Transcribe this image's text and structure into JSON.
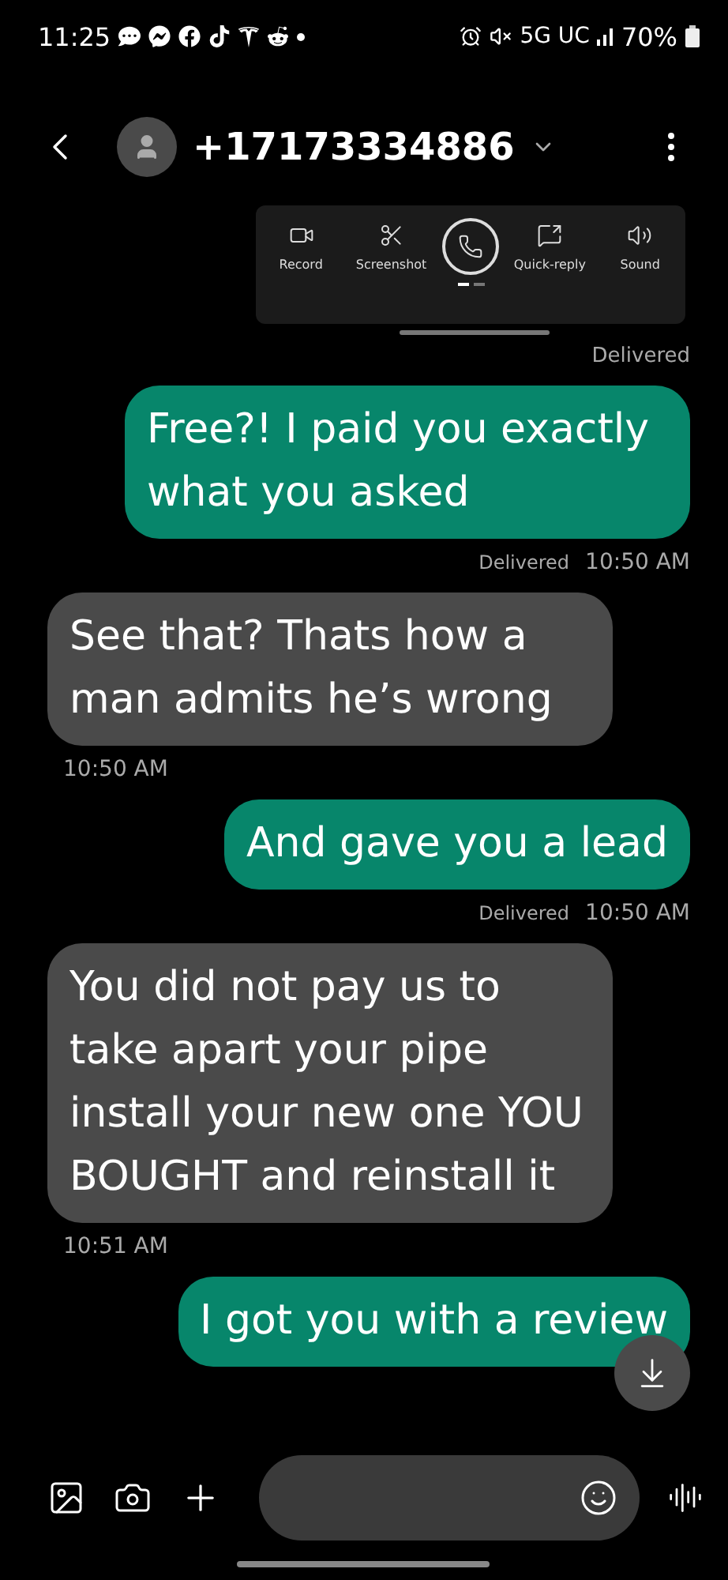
{
  "status_bar": {
    "time": "11:25",
    "network": "5G UC",
    "battery": "70%"
  },
  "header": {
    "contact": "+17173334886"
  },
  "call_panel": {
    "actions": [
      {
        "kind": "record",
        "label": "Record"
      },
      {
        "kind": "screenshot",
        "label": "Screenshot"
      },
      {
        "kind": "call"
      },
      {
        "kind": "quick-reply",
        "label": "Quick-reply"
      },
      {
        "kind": "sound",
        "label": "Sound"
      }
    ],
    "pages": [
      {
        "selected": true
      },
      {
        "selected": false
      }
    ]
  },
  "messages": [
    {
      "kind": "receipt",
      "text": "Delivered"
    },
    {
      "kind": "outgoing",
      "text": "Free?! I paid you exactly what you asked",
      "status": "Delivered",
      "time": "10:50 AM"
    },
    {
      "kind": "incoming",
      "text": "See that? Thats how a man admits he’s wrong",
      "time": "10:50 AM"
    },
    {
      "kind": "outgoing",
      "text": "And gave you a lead",
      "status": "Delivered",
      "time": "10:50 AM"
    },
    {
      "kind": "incoming",
      "text": "You did not pay us to take apart your pipe install your new one YOU BOUGHT and reinstall it",
      "time": "10:51 AM"
    },
    {
      "kind": "outgoing",
      "text": "I got you with a review"
    }
  ]
}
